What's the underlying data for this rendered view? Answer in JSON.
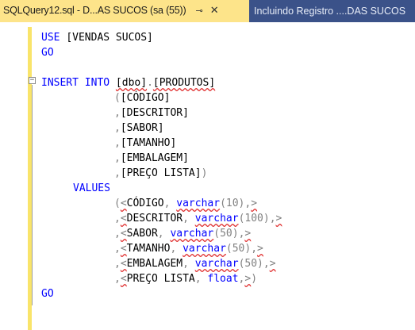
{
  "tabs": [
    {
      "title": "SQLQuery12.sql - D...AS SUCOS (sa (55))",
      "active": true
    },
    {
      "title": "Incluindo Registro ....DAS SUCOS",
      "active": false
    }
  ],
  "icons": {
    "pin": "pin-icon",
    "close": "close-icon",
    "fold": "collapse-icon"
  },
  "colors": {
    "keyword": "#0000ff",
    "punctuation": "#808080",
    "tab_active": "#fde48a",
    "tab_bar": "#2b3f6e",
    "margin_bar": "#f9e46a"
  },
  "editor": {
    "use": "USE",
    "database": "[VENDAS SUCOS]",
    "go": "GO",
    "insert_into": "INSERT INTO",
    "schema": "[dbo]",
    "dot": ".",
    "table": "[PRODUTOS]",
    "open_paren": "(",
    "close_paren": ")",
    "comma": ",",
    "values": "VALUES",
    "open_angle": "<",
    "close_angle": ">",
    "columns": [
      "[CÓDIGO]",
      "[DESCRITOR]",
      "[SABOR]",
      "[TAMANHO]",
      "[EMBALAGEM]",
      "[PREÇO LISTA]"
    ],
    "value_params": [
      {
        "name": "CÓDIGO",
        "type": "varchar",
        "arg": "(10)"
      },
      {
        "name": "DESCRITOR",
        "type": "varchar",
        "arg": "(100)"
      },
      {
        "name": "SABOR",
        "type": "varchar",
        "arg": "(50)"
      },
      {
        "name": "TAMANHO",
        "type": "varchar",
        "arg": "(50)"
      },
      {
        "name": "EMBALAGEM",
        "type": "varchar",
        "arg": "(50)"
      },
      {
        "name": "PREÇO LISTA",
        "type": "float",
        "arg": ""
      }
    ]
  }
}
